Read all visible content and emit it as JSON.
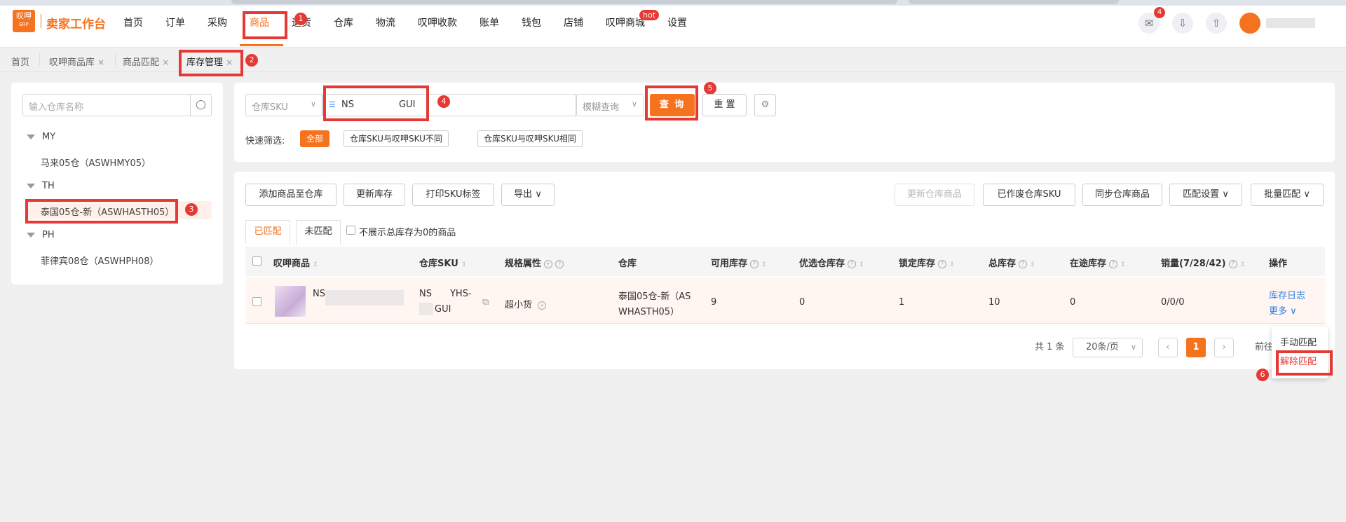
{
  "app": {
    "logo_top": "叹呷",
    "logo_bottom": "ERP",
    "title": "卖家工作台"
  },
  "nav": [
    {
      "label": "首页"
    },
    {
      "label": "订单"
    },
    {
      "label": "采购"
    },
    {
      "label": "商品"
    },
    {
      "label": "退货"
    },
    {
      "label": "仓库"
    },
    {
      "label": "物流"
    },
    {
      "label": "叹呷收款"
    },
    {
      "label": "账单"
    },
    {
      "label": "钱包"
    },
    {
      "label": "店铺"
    },
    {
      "label": "叹呷商城"
    },
    {
      "label": "设置"
    }
  ],
  "nav_hot": "hot",
  "header_icons": {
    "notify_count": "4"
  },
  "tabs": [
    {
      "label": "首页"
    },
    {
      "label": "叹呷商品库"
    },
    {
      "label": "商品匹配"
    },
    {
      "label": "库存管理"
    }
  ],
  "tab_close": "×",
  "callouts": {
    "n1": "1",
    "n2": "2",
    "n3": "3",
    "n4": "4",
    "n5": "5",
    "n6": "6"
  },
  "warehouse": {
    "placeholder": "输入仓库名称",
    "groups": [
      {
        "name": "MY",
        "items": [
          "马来05仓（ASWHMY05）"
        ]
      },
      {
        "name": "TH",
        "items": [
          "泰国05仓-新（ASWHASTH05）"
        ]
      },
      {
        "name": "PH",
        "items": [
          "菲律宾08仓（ASWHPH08）"
        ]
      }
    ]
  },
  "search": {
    "field_select": "仓库SKU",
    "sku_value": "NS",
    "sku_value_tail": "GUI",
    "match_select": "模糊查询",
    "query_btn": "查 询",
    "reset_btn": "重 置",
    "quick_label": "快速筛选:",
    "chips": [
      "全部",
      "仓库SKU与叹呷SKU不同",
      "仓库SKU与叹呷SKU相同"
    ]
  },
  "toolbar": {
    "left": [
      "添加商品至仓库",
      "更新库存",
      "打印SKU标签",
      "导出"
    ],
    "right": [
      "更新仓库商品",
      "已作废仓库SKU",
      "同步仓库商品",
      "匹配设置",
      "批量匹配"
    ]
  },
  "subtabs": [
    "已匹配",
    "未匹配"
  ],
  "hide_zero": "不展示总库存为0的商品",
  "columns": [
    "叹呷商品",
    "仓库SKU",
    "规格属性",
    "仓库",
    "可用库存",
    "优选仓库存",
    "锁定库存",
    "总库存",
    "在途库存",
    "销量(7/28/42)",
    "操作"
  ],
  "row": {
    "product_name": "NS",
    "sku_line1": "NS",
    "sku_line1_tail": "YHS-",
    "sku_line2": "GUI",
    "spec": "超小货",
    "warehouse_line1": "泰国05仓-新（AS",
    "warehouse_line2": "WHASTH05）",
    "available": "9",
    "preferred": "0",
    "locked": "1",
    "total": "10",
    "in_transit": "0",
    "sales": "0/0/0",
    "op_log": "库存日志",
    "op_more": "更多"
  },
  "pagination": {
    "total": "共 1 条",
    "page_size": "20条/页",
    "current": "1",
    "goto": "前往"
  },
  "dropdown": [
    "手动匹配",
    "解除匹配"
  ],
  "colors": {
    "accent": "#f5731f",
    "callout": "#e53935",
    "link": "#2f7de1"
  }
}
